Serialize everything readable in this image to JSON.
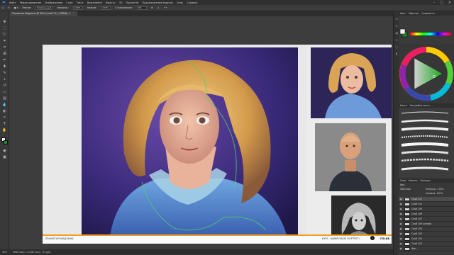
{
  "menubar": {
    "logo": "Ps",
    "items": [
      "Файл",
      "Редактирование",
      "Изображение",
      "Слои",
      "Текст",
      "Выделение",
      "Фильтр",
      "3D",
      "Просмотр",
      "Подключаемые модули",
      "Окно",
      "Справка"
    ]
  },
  "window_controls": {
    "minimize": "–",
    "maximize": "□",
    "close": "✕"
  },
  "options": {
    "mode_label": "Режим:",
    "mode_value": "Нормальный",
    "opacity_label": "Непрозр.:",
    "opacity_value": "100%",
    "pressure_label": "Нажим:",
    "pressure_value": "100%",
    "smoothing_label": "Сглаживание:",
    "smoothing_value": "0%"
  },
  "document": {
    "tab_title": "Лохматая Мадлина @ 50% (Слой 111, RGB/8) ×",
    "caption_left": "ЛОХМАТАЯ МАДЛИНА",
    "caption_right": "КУРС «ЦИФРОВОЙ ПОРТРЕТ»",
    "brand_logo": "A",
    "brand_text": "CGLAB"
  },
  "status": {
    "zoom": "50%",
    "doc_info": "3840 пикс. x 2160 пикс. (72 ppi)"
  },
  "right_panel": {
    "color_tabs": [
      "Цвет",
      "Образцы",
      "Градиенты"
    ],
    "brush_tabs": [
      "Кисти",
      "Настройки кисти"
    ],
    "layer_tabs": [
      "Слои",
      "Каналы",
      "Контуры"
    ],
    "layer_kind": "Вид",
    "blend_mode": "Обычные",
    "opacity_label": "Непрозр.: 100%",
    "fill_label": "Заливка: 100%",
    "layers": [
      {
        "name": "Слой 111",
        "active": true
      },
      {
        "name": "Слой 110",
        "active": false
      },
      {
        "name": "Слой 109",
        "active": false
      },
      {
        "name": "Слой 108",
        "active": false
      },
      {
        "name": "Слой 107",
        "active": false
      },
      {
        "name": "Слой 106 (копия)",
        "active": false
      },
      {
        "name": "Слой 105",
        "active": false
      },
      {
        "name": "Слой 104",
        "active": false
      },
      {
        "name": "Слой 103",
        "active": false
      },
      {
        "name": "Слой 102",
        "active": false
      },
      {
        "name": "Фон",
        "active": false
      }
    ]
  },
  "colors": {
    "accent": "#f0a020",
    "foreground": "#f2f2f2",
    "background": "#1c8a2a"
  }
}
